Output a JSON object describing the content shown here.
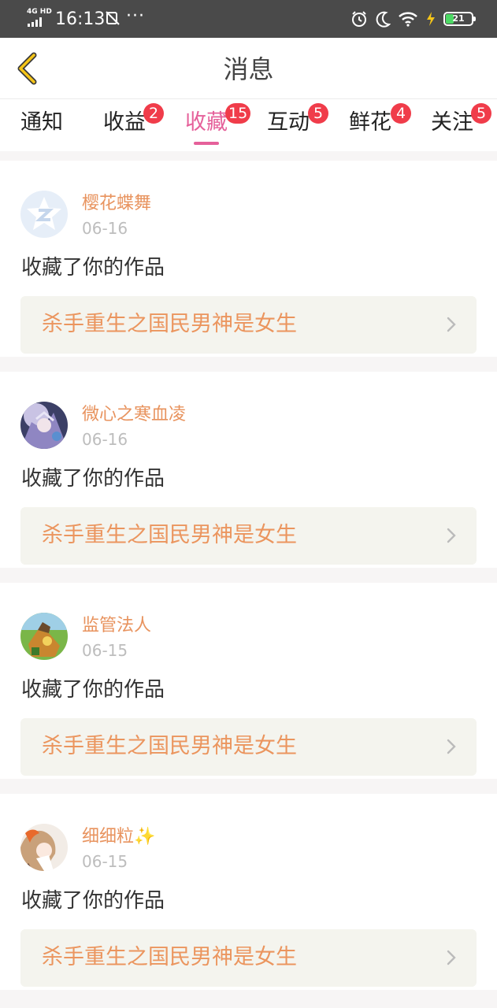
{
  "status_bar": {
    "network": "4G HD",
    "time": "16:13",
    "more": "···",
    "battery": "21",
    "colors": {
      "background": "#4a4a4a",
      "battery_fill": "#4cd964",
      "charging": "#f5c518"
    }
  },
  "header": {
    "title": "消息",
    "back_icon": "chevron-left-icon",
    "accent_color": "#f5c518"
  },
  "tabs": [
    {
      "label": "通知",
      "badge": "",
      "active": false
    },
    {
      "label": "收益",
      "badge": "2",
      "active": false
    },
    {
      "label": "收藏",
      "badge": "15",
      "active": true
    },
    {
      "label": "互动",
      "badge": "5",
      "active": false
    },
    {
      "label": "鲜花",
      "badge": "4",
      "active": false
    },
    {
      "label": "关注",
      "badge": "5",
      "active": false
    }
  ],
  "colors": {
    "active_tab": "#e5609a",
    "badge": "#f03c4a",
    "username": "#e8935e",
    "work_title": "#eb955e",
    "work_background": "#f4f4ee"
  },
  "messages": [
    {
      "username": "樱花蝶舞",
      "date": "06-16",
      "action": "收藏了你的作品",
      "work_title": "杀手重生之国民男神是女生",
      "avatar_icon": "default-avatar-icon"
    },
    {
      "username": "微心之寒血凌",
      "date": "06-16",
      "action": "收藏了你的作品",
      "work_title": "杀手重生之国民男神是女生",
      "avatar_icon": "anime-avatar-icon"
    },
    {
      "username": "监管法人",
      "date": "06-15",
      "action": "收藏了你的作品",
      "work_title": "杀手重生之国民男神是女生",
      "avatar_icon": "game-avatar-icon"
    },
    {
      "username": "细细粒✨",
      "date": "06-15",
      "action": "收藏了你的作品",
      "work_title": "杀手重生之国民男神是女生",
      "avatar_icon": "illustration-avatar-icon"
    }
  ]
}
